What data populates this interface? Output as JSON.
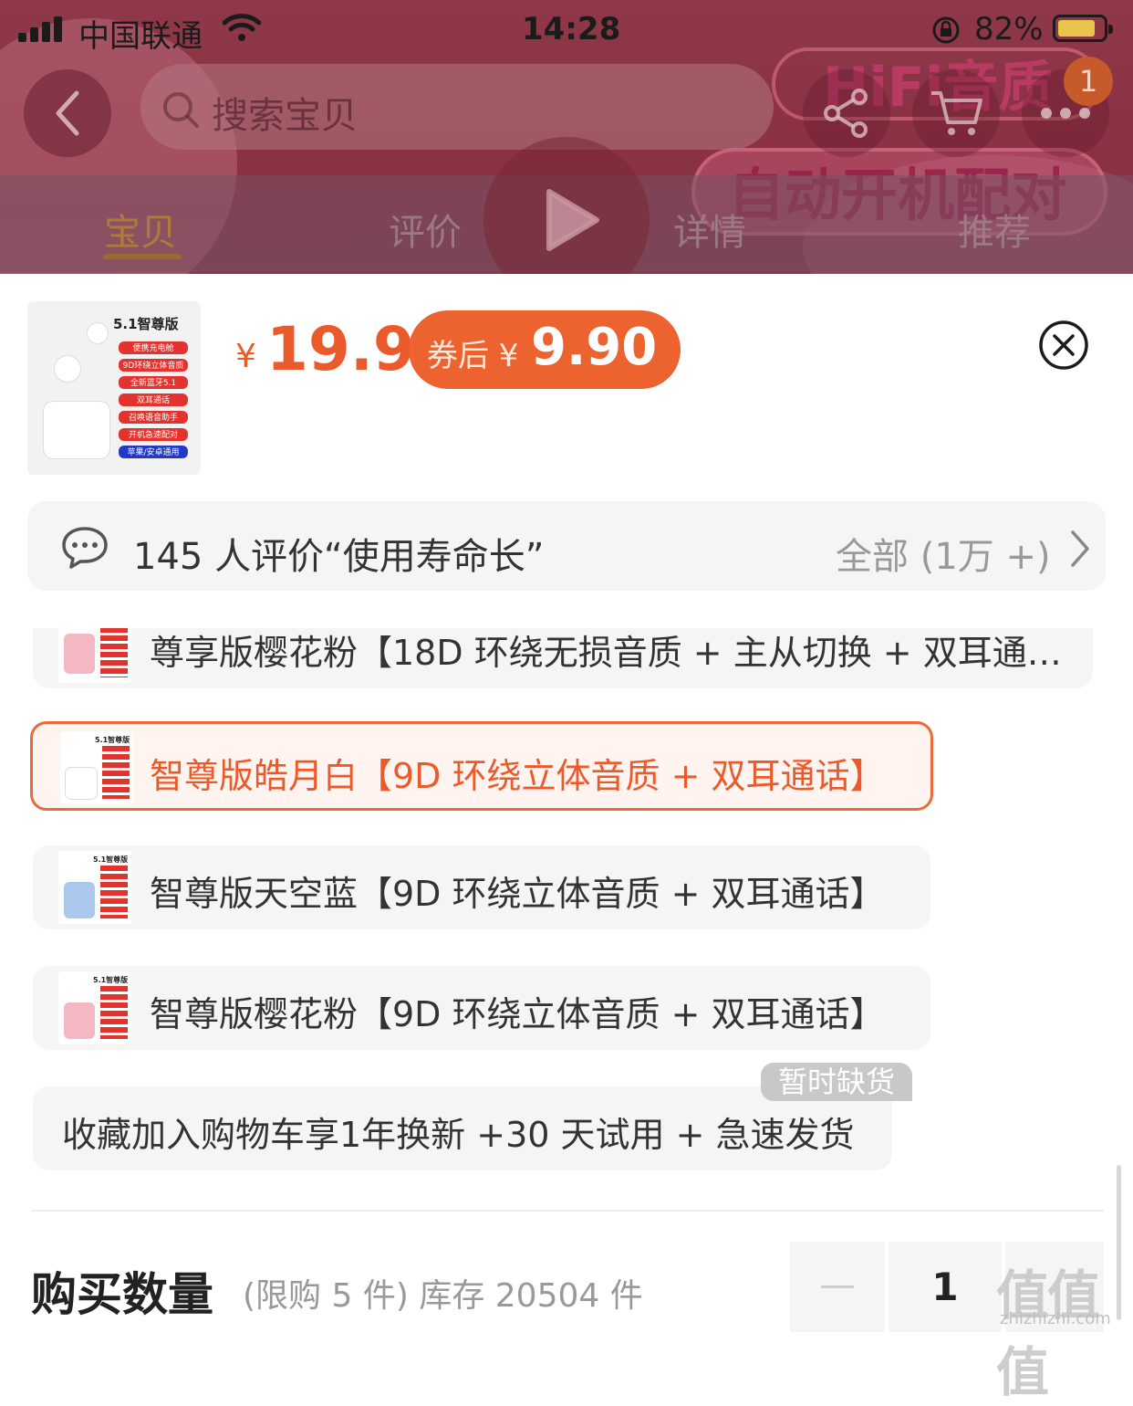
{
  "status_bar": {
    "carrier": "中国联通",
    "time": "14:28",
    "battery": "82%"
  },
  "header": {
    "search_placeholder": "搜索宝贝",
    "cart_badge": "1",
    "tabs": [
      "宝贝",
      "评价",
      "详情",
      "推荐"
    ],
    "active_tab": 0,
    "promo_1": "HiFi音质",
    "promo_2": "自动开机配对"
  },
  "product": {
    "thumb_title": "5.1智尊版",
    "thumb_tags": [
      "便携充电舱",
      "9D环绕立体音质",
      "全新蓝牙5.1",
      "双耳通话",
      "召唤语音助手",
      "开机急速配对",
      "苹果/安卓通用"
    ],
    "currency": "¥",
    "price": "19.9",
    "coupon_label": "券后 ¥",
    "coupon_price": "9.90"
  },
  "reviews": {
    "summary": "145 人评价“使用寿命长”",
    "all_label": "全部 (1万 +)"
  },
  "options": [
    {
      "label": "尊享版樱花粉【18D 环绕无损音质 + 主从切换 + 双耳通…",
      "color": "#f3b8c2",
      "selected": false
    },
    {
      "label": "智尊版皓月白【9D 环绕立体音质 + 双耳通话】",
      "color": "#ffffff",
      "selected": true
    },
    {
      "label": "智尊版天空蓝【9D 环绕立体音质 + 双耳通话】",
      "color": "#a9c8ec",
      "selected": false
    },
    {
      "label": "智尊版樱花粉【9D 环绕立体音质 + 双耳通话】",
      "color": "#f3b8c2",
      "selected": false
    }
  ],
  "extra_option": {
    "label": "收藏加入购物车享1年换新 +30 天试用 + 急速发货",
    "badge": "暂时缺货"
  },
  "quantity": {
    "title": "购买数量",
    "info": "(限购 5 件) 库存 20504 件",
    "value": "1"
  },
  "watermark": {
    "text": "值值值",
    "sub": "zhizhizhi.com"
  },
  "colors": {
    "accent": "#ea5a2a",
    "coupon_bg": "#ec6330"
  }
}
